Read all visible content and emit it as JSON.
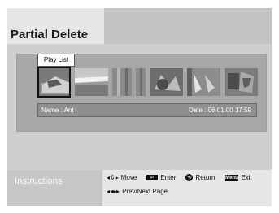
{
  "title": "Partial Delete",
  "playlist_tab": "Play List",
  "info": {
    "name": "Name : Ant",
    "date": "Date :  06.01.00 17:59"
  },
  "instructions": {
    "label": "Instructions",
    "move": "Move",
    "enter": "Enter",
    "return": "Return",
    "menu_key": "Menu",
    "exit": "Exit",
    "page": "Prev/Next Page"
  },
  "icons": {
    "move": "up-down-left-right-arrows-icon",
    "enter": "enter-key-icon",
    "return": "return-icon",
    "menu": "menu-key-icon",
    "page": "left-right-double-arrows-icon"
  },
  "thumbnails": [
    {
      "label": "thumbnail-1",
      "selected": true
    },
    {
      "label": "thumbnail-2",
      "selected": false
    },
    {
      "label": "thumbnail-3",
      "selected": false
    },
    {
      "label": "thumbnail-4",
      "selected": false
    },
    {
      "label": "thumbnail-5",
      "selected": false
    },
    {
      "label": "thumbnail-6",
      "selected": false
    }
  ]
}
